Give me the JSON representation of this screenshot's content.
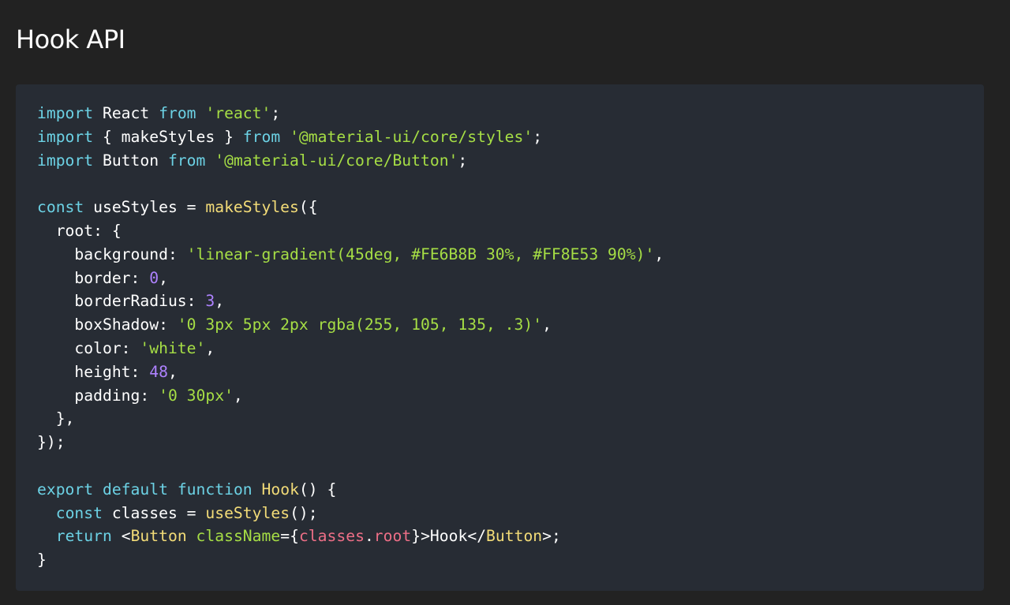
{
  "title": "Hook API",
  "colors": {
    "background": "#222222",
    "code_background": "#272c34",
    "keyword": "#6cd2e5",
    "string": "#a6de45",
    "number": "#ae82ff",
    "function": "#f3dc78",
    "property": "#ee6f87",
    "text": "#ffffff"
  },
  "code_lines": [
    [
      [
        "kw",
        "import"
      ],
      [
        "plain",
        " React "
      ],
      [
        "kw",
        "from"
      ],
      [
        "plain",
        " "
      ],
      [
        "str",
        "'react'"
      ],
      [
        "plain",
        ";"
      ]
    ],
    [
      [
        "kw",
        "import"
      ],
      [
        "plain",
        " { makeStyles } "
      ],
      [
        "kw",
        "from"
      ],
      [
        "plain",
        " "
      ],
      [
        "str",
        "'@material-ui/core/styles'"
      ],
      [
        "plain",
        ";"
      ]
    ],
    [
      [
        "kw",
        "import"
      ],
      [
        "plain",
        " Button "
      ],
      [
        "kw",
        "from"
      ],
      [
        "plain",
        " "
      ],
      [
        "str",
        "'@material-ui/core/Button'"
      ],
      [
        "plain",
        ";"
      ]
    ],
    [],
    [
      [
        "kw",
        "const"
      ],
      [
        "plain",
        " useStyles = "
      ],
      [
        "fn",
        "makeStyles"
      ],
      [
        "plain",
        "({"
      ]
    ],
    [
      [
        "plain",
        "  root: {"
      ]
    ],
    [
      [
        "plain",
        "    background: "
      ],
      [
        "str",
        "'linear-gradient(45deg, #FE6B8B 30%, #FF8E53 90%)'"
      ],
      [
        "plain",
        ","
      ]
    ],
    [
      [
        "plain",
        "    border: "
      ],
      [
        "num",
        "0"
      ],
      [
        "plain",
        ","
      ]
    ],
    [
      [
        "plain",
        "    borderRadius: "
      ],
      [
        "num",
        "3"
      ],
      [
        "plain",
        ","
      ]
    ],
    [
      [
        "plain",
        "    boxShadow: "
      ],
      [
        "str",
        "'0 3px 5px 2px rgba(255, 105, 135, .3)'"
      ],
      [
        "plain",
        ","
      ]
    ],
    [
      [
        "plain",
        "    color: "
      ],
      [
        "str",
        "'white'"
      ],
      [
        "plain",
        ","
      ]
    ],
    [
      [
        "plain",
        "    height: "
      ],
      [
        "num",
        "48"
      ],
      [
        "plain",
        ","
      ]
    ],
    [
      [
        "plain",
        "    padding: "
      ],
      [
        "str",
        "'0 30px'"
      ],
      [
        "plain",
        ","
      ]
    ],
    [
      [
        "plain",
        "  },"
      ]
    ],
    [
      [
        "plain",
        "});"
      ]
    ],
    [],
    [
      [
        "kw",
        "export"
      ],
      [
        "plain",
        " "
      ],
      [
        "kw",
        "default"
      ],
      [
        "plain",
        " "
      ],
      [
        "kw",
        "function"
      ],
      [
        "plain",
        " "
      ],
      [
        "fn",
        "Hook"
      ],
      [
        "plain",
        "() {"
      ]
    ],
    [
      [
        "plain",
        "  "
      ],
      [
        "kw",
        "const"
      ],
      [
        "plain",
        " classes = "
      ],
      [
        "fn",
        "useStyles"
      ],
      [
        "plain",
        "();"
      ]
    ],
    [
      [
        "plain",
        "  "
      ],
      [
        "kw",
        "return"
      ],
      [
        "plain",
        " <"
      ],
      [
        "fn",
        "Button"
      ],
      [
        "plain",
        " "
      ],
      [
        "attr",
        "className"
      ],
      [
        "plain",
        "={"
      ],
      [
        "prop",
        "classes"
      ],
      [
        "plain",
        "."
      ],
      [
        "prop",
        "root"
      ],
      [
        "plain",
        "}>Hook</"
      ],
      [
        "fn",
        "Button"
      ],
      [
        "plain",
        ">;"
      ]
    ],
    [
      [
        "plain",
        "}"
      ]
    ]
  ]
}
